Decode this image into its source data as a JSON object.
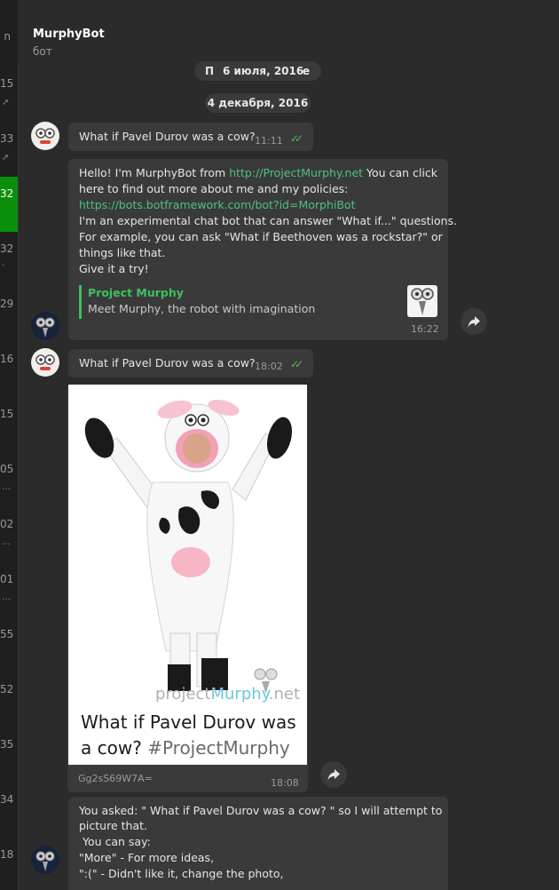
{
  "left_list": {
    "numbers": [
      "n",
      "15",
      "33",
      "32",
      "32",
      "29",
      "16",
      "15",
      "05",
      "02",
      "01",
      "55",
      "52",
      "35",
      "34",
      "18"
    ],
    "active_index": 3
  },
  "header": {
    "title": "MurphyBot",
    "subtitle": "бот"
  },
  "dates": {
    "overlay_left": "П",
    "overlay_main": "6 июля, 2016",
    "overlay_right": "е",
    "current": "4 декабря, 2016"
  },
  "messages": {
    "m1": {
      "text": "What if Pavel Durov was a cow?",
      "time": "11:11",
      "status_icon": "double-check-icon"
    },
    "m2": {
      "line1_prefix": "Hello! I'm MurphyBot from ",
      "line1_link": "http://ProjectMurphy.net",
      "line1_suffix": " You can click",
      "line2": "here to find out more about me and my policies:",
      "line3_link": "https://bots.botframework.com/bot?id=MorphiBot",
      "line4": "I'm an experimental chat bot that can answer \"What if...\" questions.",
      "line5": "For example, you can ask \"What if Beethoven was a rockstar?\" or",
      "line6": "things like that.",
      "line7": "Give it a try!",
      "preview_title": "Project Murphy",
      "preview_desc": "Meet Murphy, the robot with imagination",
      "time": "16:22"
    },
    "m3": {
      "text": "What if Pavel Durov was a cow?",
      "time": "18:02",
      "status_icon": "double-check-icon"
    },
    "m4": {
      "watermark_a": "project",
      "watermark_b": "Murphy",
      "watermark_c": ".net",
      "caption_line1": "What if Pavel Durov was",
      "caption_line2a": "a cow? ",
      "caption_line2b": "#ProjectMurphy",
      "file_name": "Gg2sS69W7A=",
      "time": "18:08"
    },
    "m5": {
      "line1": "You asked: \" What if Pavel Durov was a cow? \" so I will attempt to",
      "line2": "picture that.",
      "line3": " You can say:",
      "line4": "\"More\" - For more ideas,",
      "line5": "\":(\" - Didn't like it, change the photo,"
    }
  },
  "colors": {
    "background": "#2b2b2b",
    "bubble": "#3a3a3a",
    "link": "#4fc27a",
    "accent_green": "#3cc15f",
    "active_chat": "#0a8f0a"
  }
}
